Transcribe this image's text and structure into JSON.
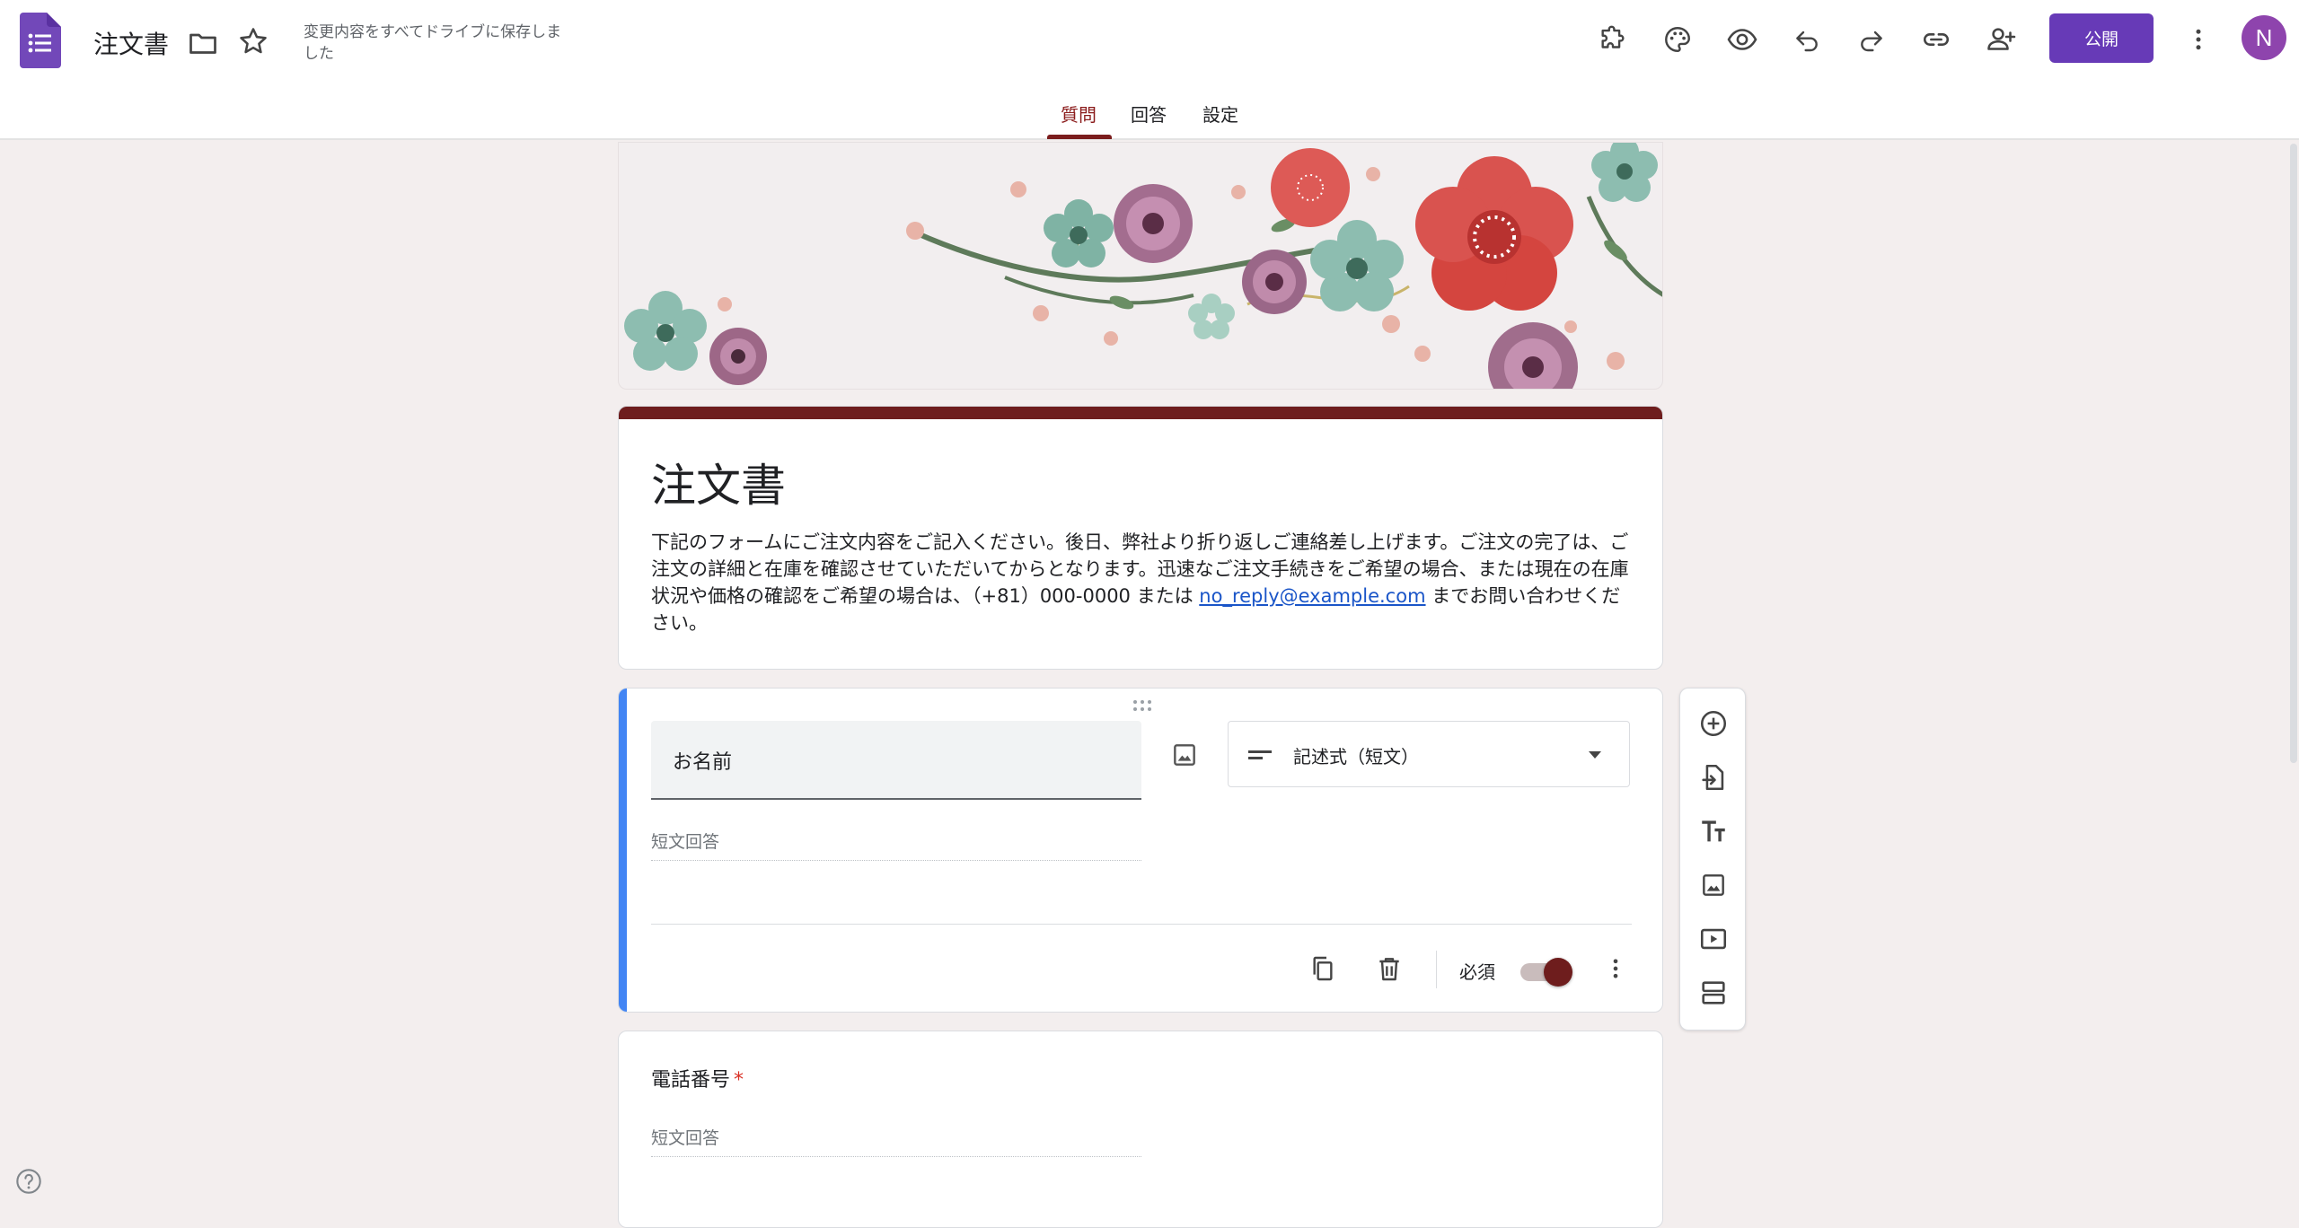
{
  "app": {
    "title": "注文書",
    "save_status": "変更内容をすべてドライブに保存しました",
    "publish_label": "公開",
    "avatar_letter": "N",
    "accent_color": "#673ab7",
    "theme_color": "#6e1d1d"
  },
  "toolbar": {
    "icons": [
      "add-on-icon",
      "palette-icon",
      "preview-icon",
      "undo-icon",
      "redo-icon",
      "link-icon",
      "add-collaborator-icon",
      "more-vert-icon"
    ]
  },
  "tabs": [
    {
      "label": "質問",
      "active": true
    },
    {
      "label": "回答",
      "active": false
    },
    {
      "label": "設定",
      "active": false
    }
  ],
  "form": {
    "title": "注文書",
    "description_before_link": "下記のフォームにご注文内容をご記入ください。後日、弊社より折り返しご連絡差し上げます。ご注文の完了は、ご注文の詳細と在庫を確認させていただいてからとなります。迅速なご注文手続きをご希望の場合、または現在の在庫状況や価格の確認をご希望の場合は、（+81）000-0000 または ",
    "description_link": "no_reply@example.com",
    "description_after_link": " までお問い合わせください。"
  },
  "questions": [
    {
      "title": "お名前",
      "type": "記述式（短文）",
      "answer_placeholder": "短文回答",
      "required_label": "必須",
      "required": true,
      "active": true
    },
    {
      "title": "電話番号",
      "required_mark": "*",
      "answer_placeholder": "短文回答",
      "active": false
    }
  ],
  "side_toolbar": {
    "icons": [
      "add-question-icon",
      "import-questions-icon",
      "add-title-icon",
      "add-image-icon",
      "add-video-icon",
      "add-section-icon"
    ]
  }
}
